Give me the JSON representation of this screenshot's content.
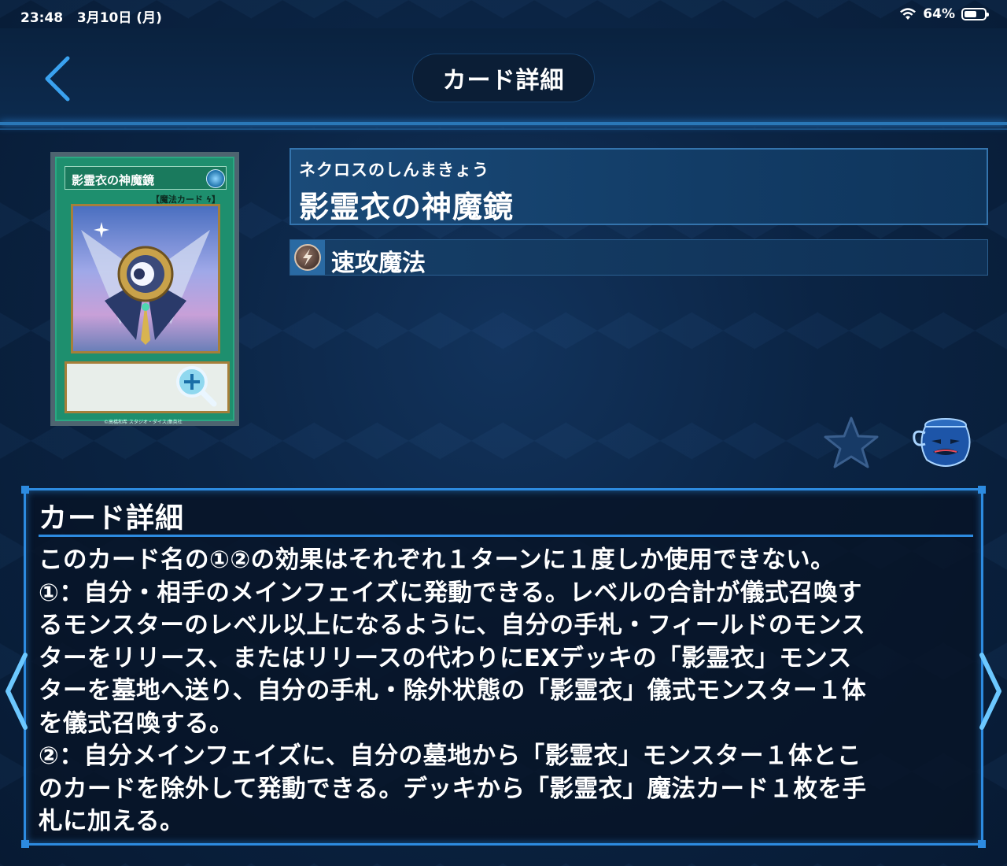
{
  "status_bar": {
    "time": "23:48",
    "date": "3月10日 (月)",
    "battery": "64%",
    "battery_level": 0.64
  },
  "header": {
    "title": "カード詳細",
    "back_icon": "chevron-left-icon"
  },
  "card": {
    "image_name_text": "影霊衣の神魔鏡",
    "image_type_text": "【魔法カード",
    "ruby": "ネクロスのしんまきょう",
    "name": "影霊衣の神魔鏡",
    "type_icon": "quick-play-spell-icon",
    "type_label": "速攻魔法"
  },
  "actions": {
    "favorite_icon": "star-icon",
    "pot_icon": "pot-of-greed-icon",
    "zoom_icon": "zoom-in-icon"
  },
  "details": {
    "title": "カード詳細",
    "lines": [
      "このカード名の①②の効果はそれぞれ１ターンに１度しか使用できない。",
      "①：自分・相手のメインフェイズに発動できる。レベルの合計が儀式召喚す",
      "るモンスターのレベル以上になるように、自分の手札・フィールドのモンス",
      "ターをリリース、またはリリースの代わりにEXデッキの「影霊衣」モンス",
      "ターを墓地へ送り、自分の手札・除外状態の「影霊衣」儀式モンスター１体",
      "を儀式召喚する。",
      "②：自分メインフェイズに、自分の墓地から「影霊衣」モンスター１体とこ",
      "のカードを除外して発動できる。デッキから「影霊衣」魔法カード１枚を手",
      "札に加える。"
    ]
  },
  "colors": {
    "accent": "#2d8be0",
    "background": "#0b2444",
    "card_frame": "#1e8f6e"
  }
}
